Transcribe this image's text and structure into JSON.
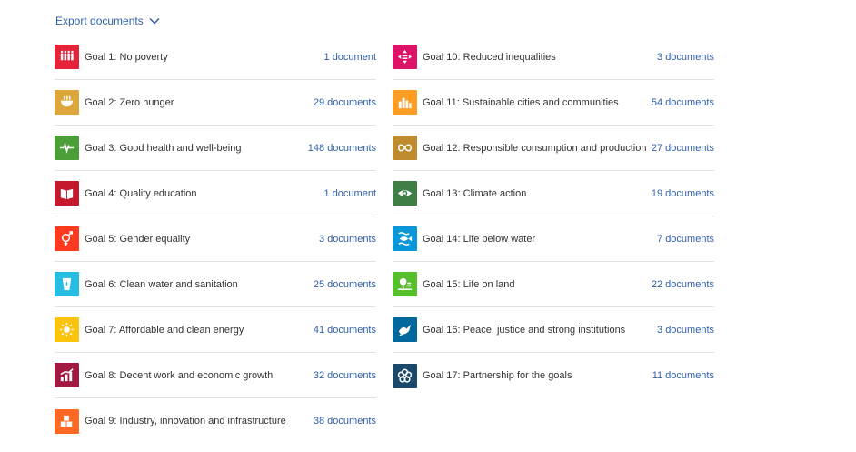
{
  "export": {
    "label": "Export documents"
  },
  "goals": [
    {
      "label": "Goal 1: No poverty",
      "count": "1 document",
      "color": "#e5243b",
      "icon": "people-icon"
    },
    {
      "label": "Goal 2: Zero hunger",
      "count": "29 documents",
      "color": "#dda63a",
      "icon": "bowl-icon"
    },
    {
      "label": "Goal 3: Good health and well-being",
      "count": "148 documents",
      "color": "#4c9f38",
      "icon": "heartbeat-icon"
    },
    {
      "label": "Goal 4: Quality education",
      "count": "1 document",
      "color": "#c5192d",
      "icon": "book-icon"
    },
    {
      "label": "Goal 5: Gender equality",
      "count": "3 documents",
      "color": "#ff3a21",
      "icon": "gender-icon"
    },
    {
      "label": "Goal 6: Clean water and sanitation",
      "count": "25 documents",
      "color": "#26bde2",
      "icon": "water-glass-icon"
    },
    {
      "label": "Goal 7: Affordable and clean energy",
      "count": "41 documents",
      "color": "#fcc30b",
      "icon": "sun-icon"
    },
    {
      "label": "Goal 8: Decent work and economic growth",
      "count": "32 documents",
      "color": "#a21942",
      "icon": "growth-chart-icon"
    },
    {
      "label": "Goal 9: Industry, innovation and infrastructure",
      "count": "38 documents",
      "color": "#fd6925",
      "icon": "cubes-icon"
    },
    {
      "label": "Goal 10: Reduced inequalities",
      "count": "3 documents",
      "color": "#dd1367",
      "icon": "equality-icon"
    },
    {
      "label": "Goal 11: Sustainable cities and communities",
      "count": "54 documents",
      "color": "#fd9d24",
      "icon": "city-icon"
    },
    {
      "label": "Goal 12: Responsible consumption and production",
      "count": "27 documents",
      "color": "#bf8b2e",
      "icon": "infinity-icon"
    },
    {
      "label": "Goal 13: Climate action",
      "count": "19 documents",
      "color": "#3f7e44",
      "icon": "eye-globe-icon"
    },
    {
      "label": "Goal 14: Life below water",
      "count": "7 documents",
      "color": "#0a97d9",
      "icon": "fish-icon"
    },
    {
      "label": "Goal 15: Life on land",
      "count": "22 documents",
      "color": "#56c02b",
      "icon": "tree-icon"
    },
    {
      "label": "Goal 16: Peace, justice and strong institutions",
      "count": "3 documents",
      "color": "#00689d",
      "icon": "dove-icon"
    },
    {
      "label": "Goal 17: Partnership for the goals",
      "count": "11 documents",
      "color": "#19486a",
      "icon": "flower-icon"
    }
  ]
}
